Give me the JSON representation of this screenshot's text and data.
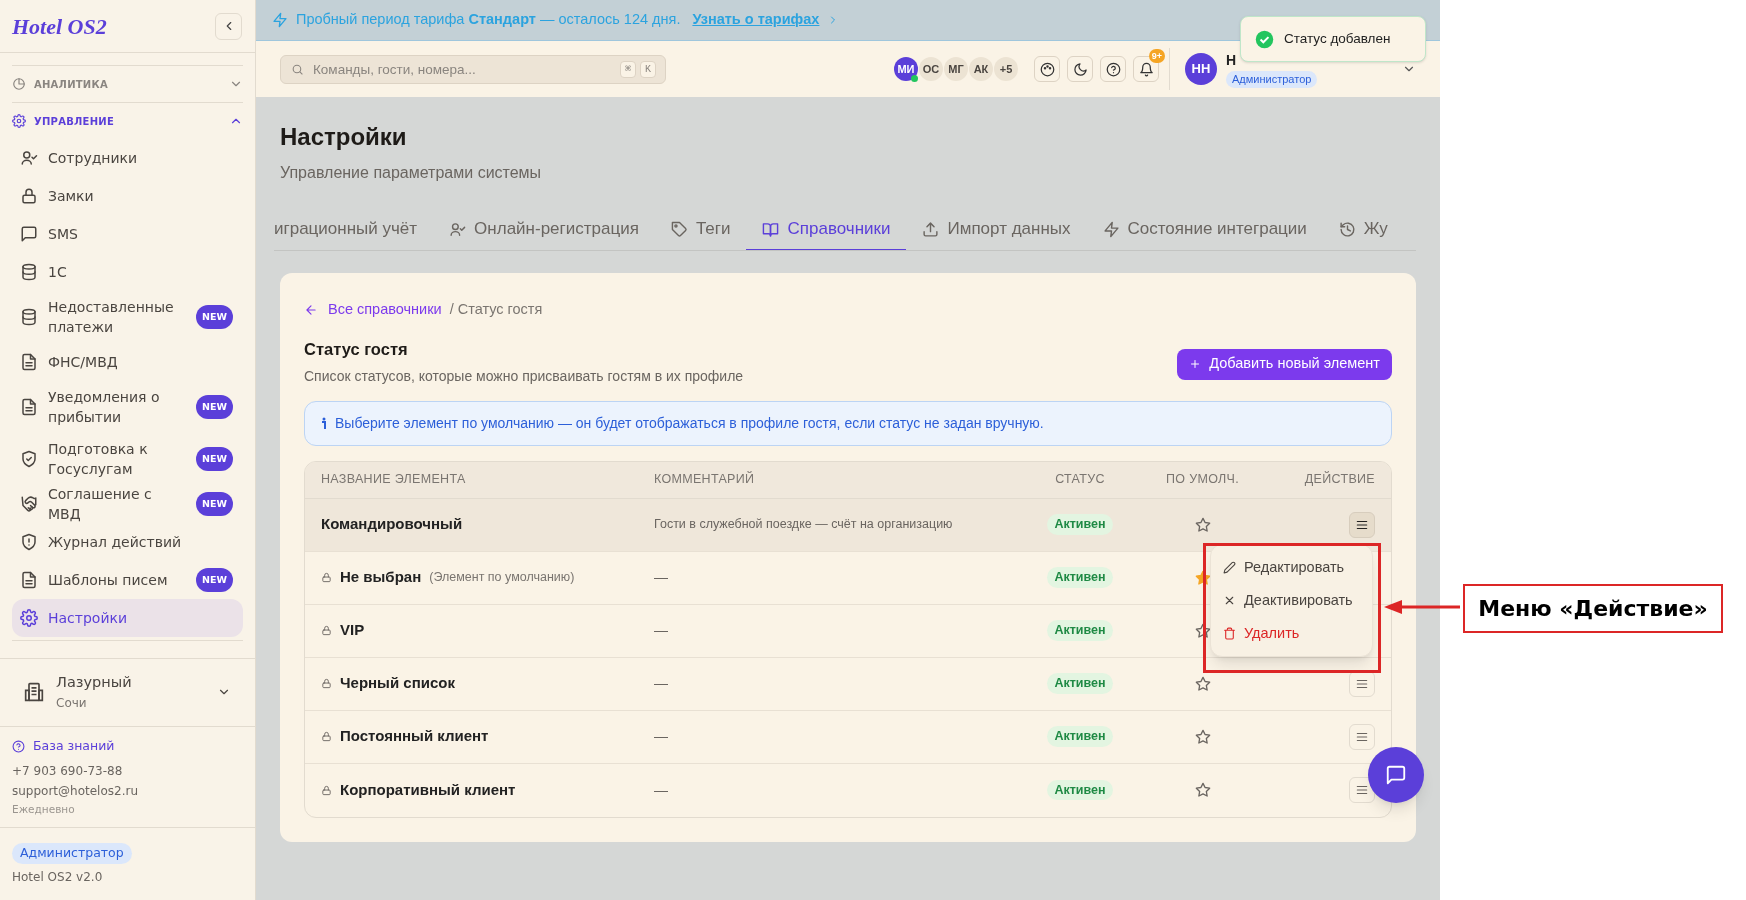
{
  "sidebar": {
    "logo": "Hotel OS2",
    "sections": [
      {
        "label": "АНАЛИТИКА",
        "expanded": false
      },
      {
        "label": "УПРАВЛЕНИЕ",
        "expanded": true
      }
    ],
    "items": [
      {
        "label": "Сотрудники",
        "selected": false
      },
      {
        "label": "Замки",
        "selected": false
      },
      {
        "label": "SMS",
        "selected": false
      },
      {
        "label": "1С",
        "selected": false
      },
      {
        "label": "Недоставленные платежи",
        "badge": "NEW",
        "selected": false
      },
      {
        "label": "ФНС/МВД",
        "selected": false
      },
      {
        "label": "Уведомления о прибытии",
        "badge": "NEW",
        "selected": false
      },
      {
        "label": "Подготовка к Госуслугам",
        "badge": "NEW",
        "selected": false
      },
      {
        "label": "Соглашение с МВД",
        "badge": "NEW",
        "selected": false
      },
      {
        "label": "Журнал действий",
        "selected": false
      },
      {
        "label": "Шаблоны писем",
        "badge": "NEW",
        "selected": false
      },
      {
        "label": "Настройки",
        "selected": true
      }
    ],
    "hotel": {
      "name": "Лазурный",
      "city": "Сочи"
    },
    "help": {
      "link": "База знаний",
      "phone": "+7 903 690-73-88",
      "email": "support@hotelos2.ru",
      "hours": "Ежедневно"
    },
    "role": "Администратор",
    "version": "Hotel OS2 v2.0"
  },
  "banner": {
    "text": "Пробный период тарифа **Стандарт** — осталось 124 дня.",
    "link": "Узнать о тарифах"
  },
  "header": {
    "search_placeholder": "Команды, гости, номера...",
    "shortcut_keys": [
      "⌘",
      "K"
    ],
    "avatars": [
      {
        "initials": "МИ",
        "color": "#5b3fd9",
        "online": true
      },
      {
        "initials": "ОС",
        "color": "#ece3d3",
        "online": false
      },
      {
        "initials": "МГ",
        "color": "#ece3d3",
        "online": false
      },
      {
        "initials": "АК",
        "color": "#ece3d3",
        "online": false
      }
    ],
    "more": "+5",
    "notifications_badge": "9+",
    "user": {
      "initials": "НН",
      "name": "Н",
      "role": "Администратор"
    }
  },
  "toast": "Статус добавлен",
  "page": {
    "title": "Настройки",
    "subtitle": "Управление параметрами системы"
  },
  "tabs": [
    {
      "label": "играционный учёт",
      "selected": false
    },
    {
      "label": "Онлайн-регистрация",
      "selected": false
    },
    {
      "label": "Теги",
      "selected": false
    },
    {
      "label": "Справочники",
      "selected": true
    },
    {
      "label": "Импорт данных",
      "selected": false
    },
    {
      "label": "Состояние интеграции",
      "selected": false
    },
    {
      "label": "Жу",
      "selected": false
    }
  ],
  "breadcrumb": {
    "back": "Все справочники",
    "current": "/ Статус гостя"
  },
  "section": {
    "title": "Статус гостя",
    "description": "Список статусов, которые можно присваивать гостям в их профиле",
    "add_button": "Добавить новый элемент"
  },
  "info": "Выберите элемент по умолчанию — он будет отображаться в профиле гостя, если статус не задан вручную.",
  "table": {
    "columns": [
      "НАЗВАНИЕ ЭЛЕМЕНТА",
      "КОММЕНТАРИЙ",
      "СТАТУС",
      "ПО УМОЛЧ.",
      "ДЕЙСТВИЕ"
    ],
    "rows": [
      {
        "name": "Командировочный",
        "comment": "Гости в служебной поездке — счёт на организацию",
        "status": "Активен",
        "locked": false,
        "default": false,
        "selected": true
      },
      {
        "name": "Не выбран",
        "note": "(Элемент по умолчанию)",
        "comment": "—",
        "status": "Активен",
        "locked": true,
        "default": true,
        "selected": false
      },
      {
        "name": "VIP",
        "comment": "—",
        "status": "Активен",
        "locked": true,
        "default": false,
        "selected": false
      },
      {
        "name": "Черный список",
        "comment": "—",
        "status": "Активен",
        "locked": true,
        "default": false,
        "selected": false
      },
      {
        "name": "Постоянный клиент",
        "comment": "—",
        "status": "Активен",
        "locked": true,
        "default": false,
        "selected": false
      },
      {
        "name": "Корпоративный клиент",
        "comment": "—",
        "status": "Активен",
        "locked": true,
        "default": false,
        "selected": false
      }
    ]
  },
  "action_menu": {
    "items": [
      {
        "label": "Редактировать",
        "kind": "edit"
      },
      {
        "label": "Деактивировать",
        "kind": "deactivate"
      },
      {
        "label": "Удалить",
        "kind": "delete"
      }
    ]
  },
  "annotation": "Меню «Действие»"
}
